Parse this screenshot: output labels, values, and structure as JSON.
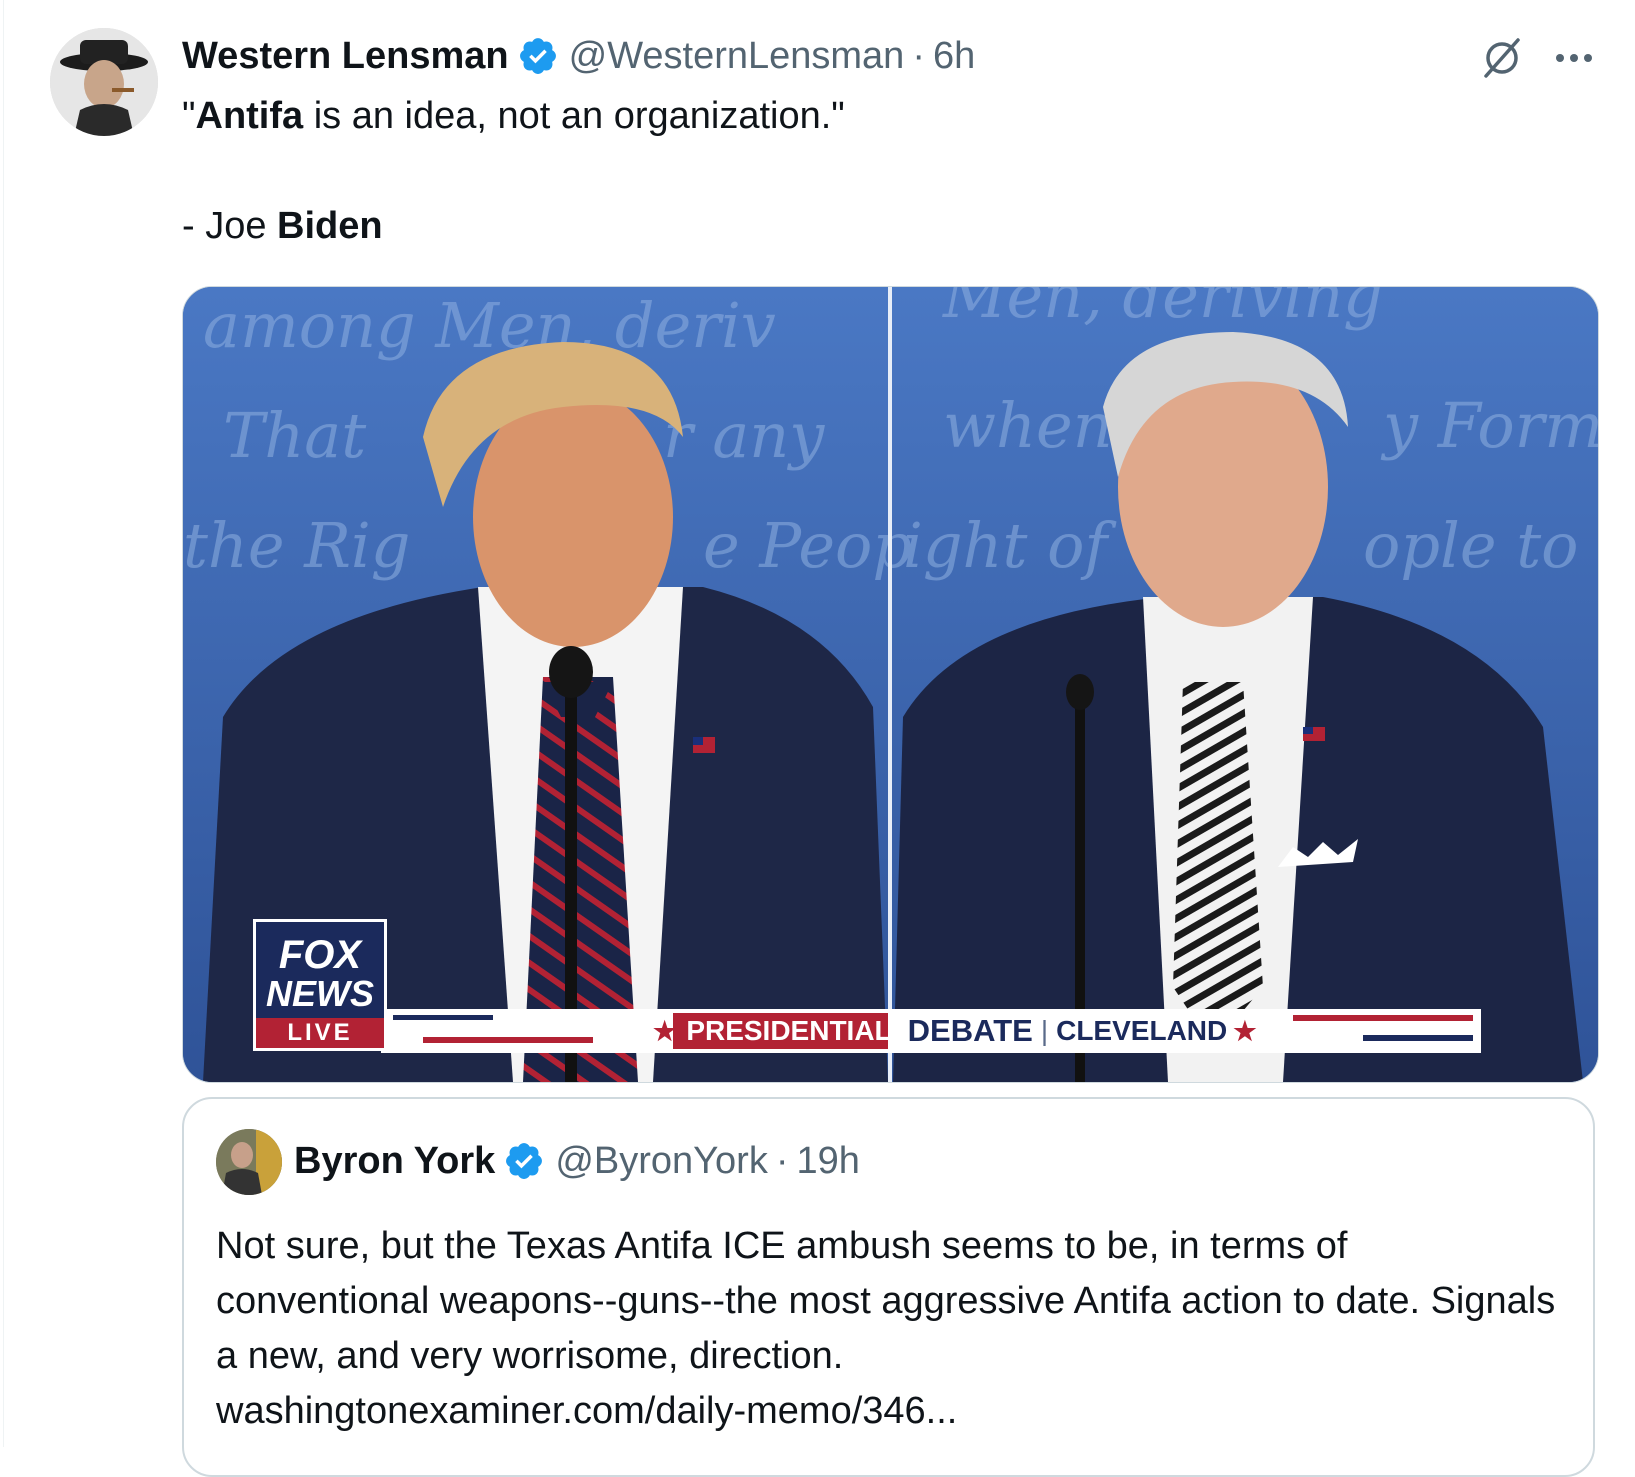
{
  "tweet": {
    "author_name": "Western Lensman",
    "handle": "@WesternLensman",
    "separator": "·",
    "time": "6h",
    "avatar_icon": "cowboy-portrait-avatar",
    "text_line1_bold": "Antifa",
    "text_line1_open_quote": "\"",
    "text_line1_rest": " is an idea, not an organization.\"",
    "text_line2_prefix": "- Joe ",
    "text_line2_bold": "Biden",
    "actions": {
      "grok_icon": "grok-icon",
      "more_icon": "more-icon"
    }
  },
  "media": {
    "description_icon": "debate-screenshot",
    "network_logo_line1": "FOX",
    "network_logo_line2": "NEWS",
    "network_logo_line3": "LIVE",
    "banner_part1": "PRESIDENTIAL",
    "banner_part2": "DEBATE",
    "banner_separator": "|",
    "banner_part3": "CLEVELAND",
    "banner_star": "★"
  },
  "quote": {
    "author_name": "Byron York",
    "handle": "@ByronYork",
    "separator": "·",
    "time": "19h",
    "text": "Not sure, but the Texas Antifa ICE ambush seems to be, in terms of conventional weapons--guns--the most aggressive Antifa action to date. Signals a new, and very worrisome, direction.",
    "link": "washingtonexaminer.com/daily-memo/346..."
  },
  "colors": {
    "verified_blue": "#1d9bf0",
    "secondary_text": "#536471",
    "border": "#cfd9de",
    "stage_blue": "#3a62a8",
    "fox_red": "#b22234",
    "fox_navy": "#1b2a5c"
  }
}
